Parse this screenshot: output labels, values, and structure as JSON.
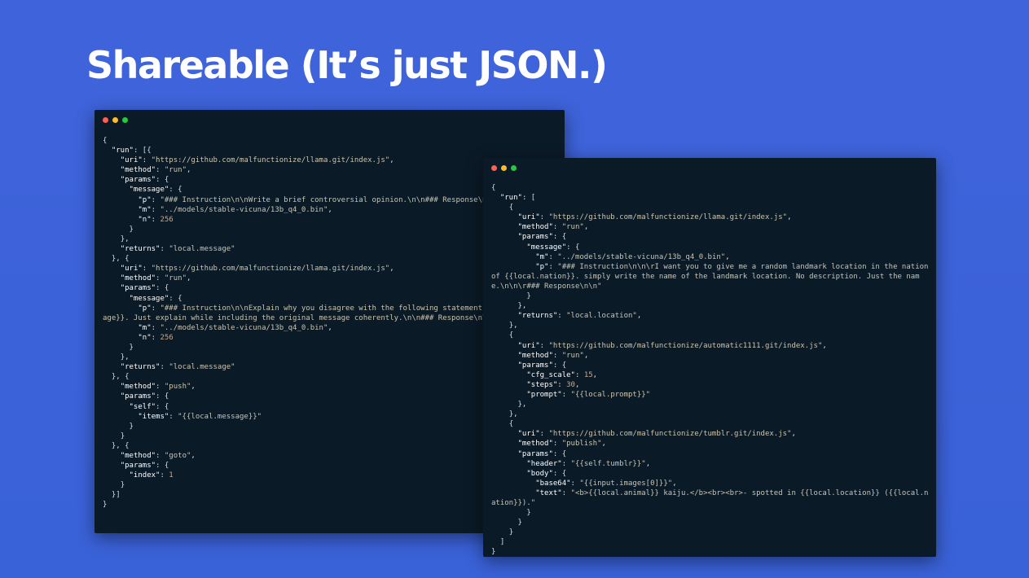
{
  "slide": {
    "title": "Shareable (It’s just JSON.)",
    "background_color": "#3d62d9"
  },
  "colors": {
    "window_bg": "#0b1a27",
    "close_dot": "#ff5f57",
    "minimize_dot": "#febc2e",
    "maximize_dot": "#28c840",
    "code_key": "#ffffff",
    "code_string": "#c9c5b2",
    "code_number": "#c9a98a"
  },
  "windows": [
    {
      "lines": [
        "{",
        "  \"run\": [{",
        "    \"uri\": \"https://github.com/malfunctionize/llama.git/index.js\",",
        "    \"method\": \"run\",",
        "    \"params\": {",
        "      \"message\": {",
        "        \"p\": \"### Instruction\\n\\nWrite a brief controversial opinion.\\n\\n### Response\\n\\n\",",
        "        \"m\": \"../models/stable-vicuna/13b_q4_0.bin\",",
        "        \"n\": 256",
        "      }",
        "    },",
        "    \"returns\": \"local.message\"",
        "  }, {",
        "    \"uri\": \"https://github.com/malfunctionize/llama.git/index.js\",",
        "    \"method\": \"run\",",
        "    \"params\": {",
        "      \"message\": {",
        "        \"p\": \"### Instruction\\n\\nExplain why you disagree with the following statement:\\n\\n{{local.message}}. Just explain while including the original message coherently.\\n\\n### Response\\n\\n\",",
        "        \"m\": \"../models/stable-vicuna/13b_q4_0.bin\",",
        "        \"n\": 256",
        "      }",
        "    },",
        "    \"returns\": \"local.message\"",
        "  }, {",
        "    \"method\": \"push\",",
        "    \"params\": {",
        "      \"self\": {",
        "        \"items\": \"{{local.message}}\"",
        "      }",
        "    }",
        "  }, {",
        "    \"method\": \"goto\",",
        "    \"params\": {",
        "      \"index\": 1",
        "    }",
        "  }]",
        "}"
      ]
    },
    {
      "lines": [
        "{",
        "  \"run\": [",
        "    {",
        "      \"uri\": \"https://github.com/malfunctionize/llama.git/index.js\",",
        "      \"method\": \"run\",",
        "      \"params\": {",
        "        \"message\": {",
        "          \"m\": \"../models/stable-vicuna/13b_q4_0.bin\",",
        "          \"p\": \"### Instruction\\n\\n\\rI want you to give me a random landmark location in the nation of {{local.nation}}. simply write the name of the landmark location. No description. Just the name.\\n\\n\\r### Response\\n\\n\"",
        "        }",
        "      },",
        "      \"returns\": \"local.location\",",
        "    },",
        "    {",
        "      \"uri\": \"https://github.com/malfunctionize/automatic1111.git/index.js\",",
        "      \"method\": \"run\",",
        "      \"params\": {",
        "        \"cfg_scale\": 15,",
        "        \"steps\": 30,",
        "        \"prompt\": \"{{local.prompt}}\"",
        "      },",
        "    },",
        "    {",
        "      \"uri\": \"https://github.com/malfunctionize/tumblr.git/index.js\",",
        "      \"method\": \"publish\",",
        "      \"params\": {",
        "        \"header\": \"{{self.tumblr}}\",",
        "        \"body\": {",
        "          \"base64\": \"{{input.images[0]}}\",",
        "          \"text\": \"<b>{{local.animal}} kaiju.</b><br><br>- spotted in {{local.location}} ({{local.nation}}).\"",
        "        }",
        "      }",
        "    }",
        "  ]",
        "}"
      ]
    }
  ]
}
